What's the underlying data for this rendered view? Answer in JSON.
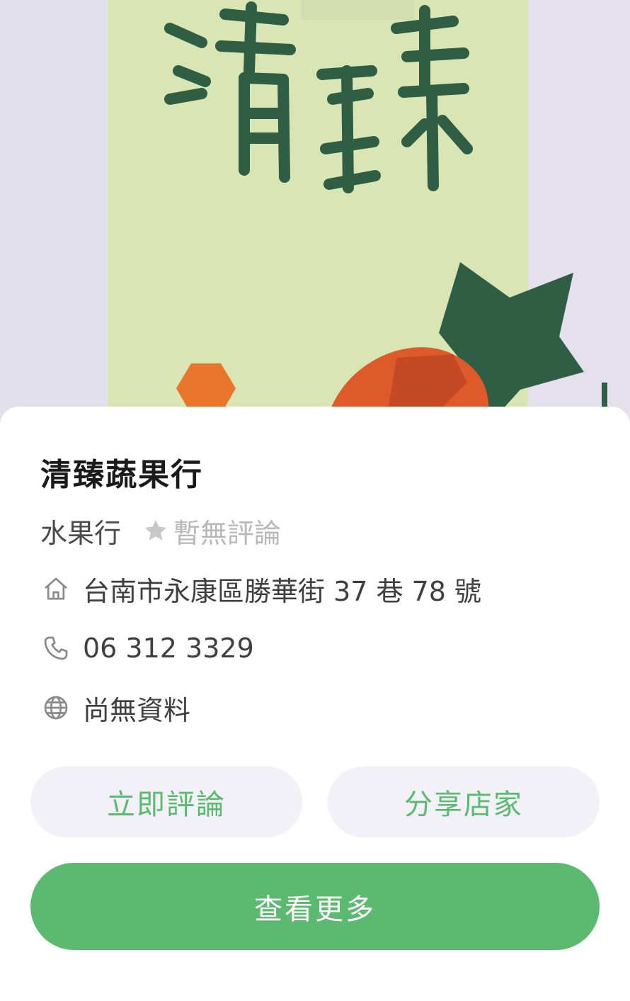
{
  "store": {
    "name": "清臻蔬果行",
    "category": "水果行",
    "rating_text": "暫無評論"
  },
  "details": {
    "address": "台南市永康區勝華街 37 巷 78 號",
    "phone": "06 312 3329",
    "website": "尚無資料"
  },
  "actions": {
    "review_label": "立即評論",
    "share_label": "分享店家",
    "more_label": "查看更多"
  },
  "colors": {
    "accent_green": "#5cba70",
    "pill_bg": "#f2f1f7",
    "hero_bg": "#e6e3ee",
    "sign_bg": "#d9e6b4",
    "sign_ink": "#2f5e44",
    "carrot": "#df5a2a"
  },
  "icons": {
    "rating": "star-icon",
    "address": "home-icon",
    "phone": "phone-icon",
    "website": "globe-icon"
  }
}
